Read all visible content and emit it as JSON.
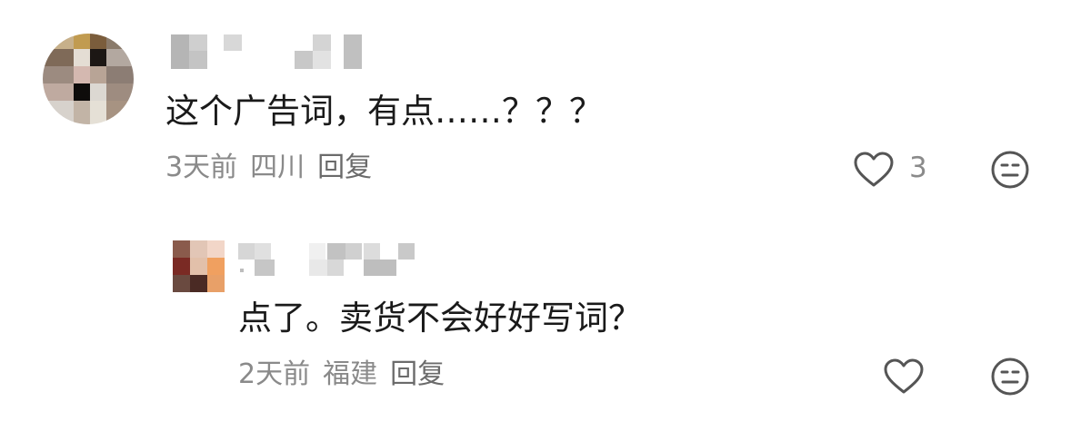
{
  "comments": [
    {
      "text": "这个广告词，有点……？？？",
      "time": "3天前",
      "location": "四川",
      "reply_label": "回复",
      "like_count": "3",
      "like_icon": "heart-outline-icon",
      "emoji_icon": "neutral-face-icon"
    },
    {
      "text": "点了。卖货不会好好写词？",
      "time": "2天前",
      "location": "福建",
      "reply_label": "回复",
      "like_icon": "heart-outline-icon",
      "emoji_icon": "neutral-face-icon"
    }
  ],
  "colors": {
    "text": "#1a1a1a",
    "meta": "#8a8a8a",
    "icon_stroke": "#555555"
  }
}
